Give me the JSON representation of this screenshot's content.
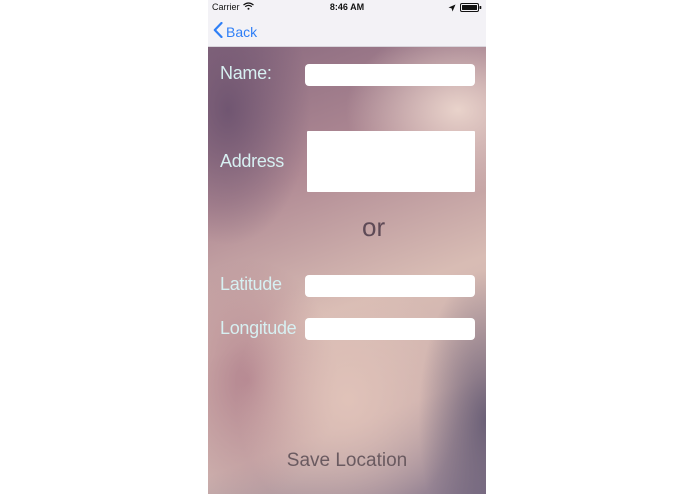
{
  "status_bar": {
    "carrier": "Carrier",
    "wifi_icon": "wifi-icon",
    "time": "8:46 AM",
    "location_icon": "location-arrow-icon",
    "battery_icon": "battery-icon"
  },
  "nav": {
    "back_label": "Back",
    "back_icon": "chevron-left-icon",
    "accent_color": "#2f7ff6"
  },
  "form": {
    "name_label": "Name:",
    "name_value": "",
    "address_label": "Address",
    "address_value": "",
    "or_text": "or",
    "latitude_label": "Latitude",
    "latitude_value": "",
    "longitude_label": "Longitude",
    "longitude_value": "",
    "save_label": "Save Location"
  }
}
